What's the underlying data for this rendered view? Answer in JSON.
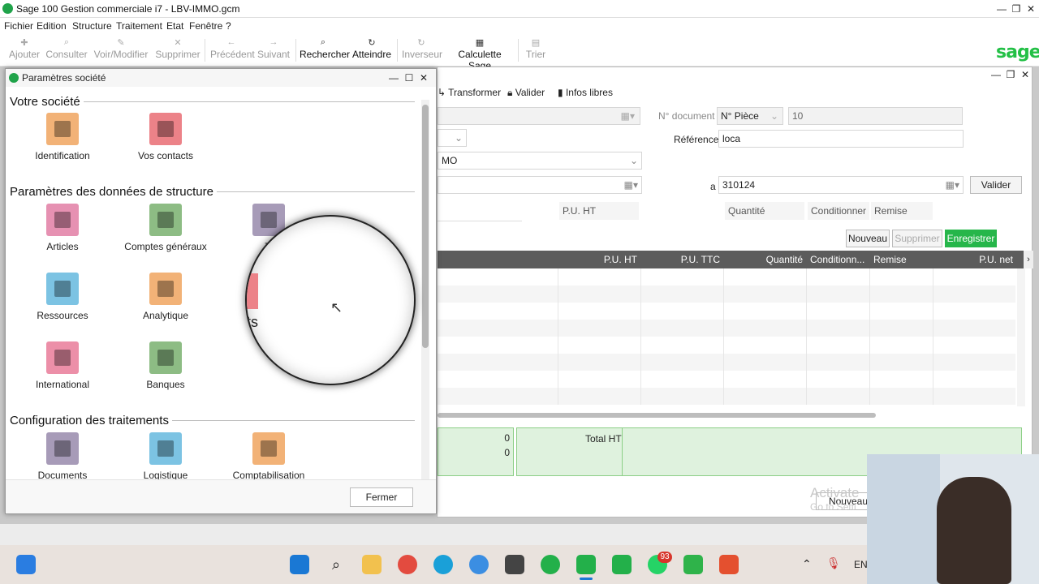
{
  "app": {
    "title": "Sage 100 Gestion commerciale i7 - LBV-IMMO.gcm",
    "brand": "sage",
    "accent_color": "#26b64a"
  },
  "menu": [
    "Fichier",
    "Edition",
    "Structure",
    "Traitement",
    "Etat",
    "Fenêtre",
    "?"
  ],
  "toolbar": {
    "ajouter": "Ajouter",
    "consulter": "Consulter",
    "voir_modifier": "Voir/Modifier",
    "supprimer": "Supprimer",
    "precedent": "Précédent",
    "suivant": "Suivant",
    "rechercher": "Rechercher",
    "atteindre": "Atteindre",
    "inverseur": "Inverseur",
    "calculette": "Calculette Sage",
    "trier": "Trier"
  },
  "document": {
    "actions": {
      "transformer": "Transformer",
      "valider": "Valider",
      "infos_libres": "Infos libres"
    },
    "n_document_label": "N° document",
    "n_piece": "N° Pièce",
    "n_value": "10",
    "reference_label": "Référence",
    "reference_value": "loca",
    "tiers_partial": "MO",
    "a_label": "a",
    "a_value": "310124",
    "valider_button": "Valider",
    "entry_columns": {
      "pu_ht": "P.U. HT",
      "quantite": "Quantité",
      "conditionner": "Conditionner",
      "remise": "Remise"
    },
    "buttons": {
      "nouveau": "Nouveau",
      "supprimer": "Supprimer",
      "enregistrer": "Enregistrer"
    },
    "grid_columns": [
      "P.U. HT",
      "P.U. TTC",
      "Quantité",
      "Conditionn...",
      "Remise",
      "P.U. net"
    ],
    "totals": {
      "v1": "0",
      "v2": "0",
      "total_ht_label": "Total HT"
    },
    "footer_nouveau": "Nouveau",
    "watermark_line1": "Activate",
    "watermark_line2": "Go to Setti"
  },
  "dialog": {
    "title": "Paramètres société",
    "sections": {
      "votre_societe": {
        "label": "Votre société",
        "items": [
          "Identification",
          "Vos contacts"
        ]
      },
      "structure": {
        "label": "Paramètres des données de structure",
        "items": [
          "Articles",
          "Comptes généraux",
          "Ti",
          "Ressources",
          "Analytique",
          "International",
          "Banques"
        ]
      },
      "traitements": {
        "label": "Configuration des traitements",
        "items": [
          "Documents",
          "Logistique",
          "Comptabilisation"
        ]
      }
    },
    "magnified_text": "ts",
    "fermer": "Fermer"
  },
  "taskbar": {
    "whatsapp_badge": "93",
    "lang": "EN"
  }
}
